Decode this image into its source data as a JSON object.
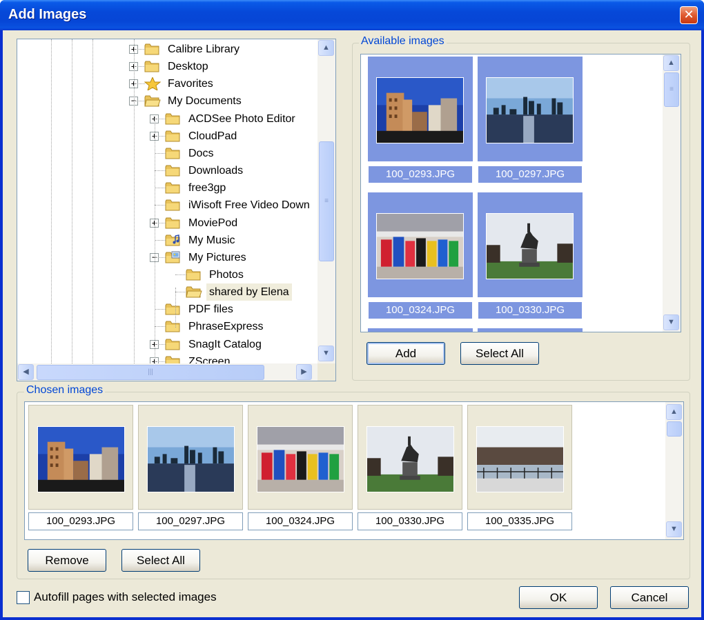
{
  "window": {
    "title": "Add Images"
  },
  "tree": {
    "items": [
      {
        "label": "Calibre Library",
        "level": 0,
        "expander": "+",
        "icon": "folder-icon"
      },
      {
        "label": "Desktop",
        "level": 0,
        "expander": "+",
        "icon": "folder-icon"
      },
      {
        "label": "Favorites",
        "level": 0,
        "expander": "+",
        "icon": "star-icon"
      },
      {
        "label": "My Documents",
        "level": 0,
        "expander": "−",
        "icon": "folder-open-icon"
      },
      {
        "label": "ACDSee Photo Editor",
        "level": 1,
        "expander": "+",
        "icon": "folder-icon"
      },
      {
        "label": "CloudPad",
        "level": 1,
        "expander": "+",
        "icon": "folder-icon"
      },
      {
        "label": "Docs",
        "level": 1,
        "expander": "",
        "icon": "folder-icon"
      },
      {
        "label": "Downloads",
        "level": 1,
        "expander": "",
        "icon": "folder-icon"
      },
      {
        "label": "free3gp",
        "level": 1,
        "expander": "",
        "icon": "folder-icon"
      },
      {
        "label": "iWisoft Free Video Down",
        "level": 1,
        "expander": "",
        "icon": "folder-icon"
      },
      {
        "label": "MoviePod",
        "level": 1,
        "expander": "+",
        "icon": "folder-icon"
      },
      {
        "label": "My Music",
        "level": 1,
        "expander": "",
        "icon": "music-folder-icon"
      },
      {
        "label": "My Pictures",
        "level": 1,
        "expander": "−",
        "icon": "pictures-folder-icon"
      },
      {
        "label": "Photos",
        "level": 2,
        "expander": "",
        "icon": "folder-icon"
      },
      {
        "label": "shared by Elena",
        "level": 2,
        "expander": "",
        "icon": "folder-open-icon",
        "selected": true
      },
      {
        "label": "PDF files",
        "level": 1,
        "expander": "",
        "icon": "folder-icon"
      },
      {
        "label": "PhraseExpress",
        "level": 1,
        "expander": "",
        "icon": "folder-icon"
      },
      {
        "label": "SnagIt Catalog",
        "level": 1,
        "expander": "+",
        "icon": "folder-icon"
      },
      {
        "label": "ZScreen",
        "level": 1,
        "expander": "+",
        "icon": "folder-icon"
      }
    ]
  },
  "available": {
    "label": "Available images",
    "images": [
      {
        "name": "100_0293.JPG",
        "scene": "building"
      },
      {
        "name": "100_0297.JPG",
        "scene": "skyline"
      },
      {
        "name": "100_0324.JPG",
        "scene": "newsboxes"
      },
      {
        "name": "100_0330.JPG",
        "scene": "statue"
      }
    ],
    "add_label": "Add",
    "select_all_label": "Select All"
  },
  "chosen": {
    "label": "Chosen images",
    "images": [
      {
        "name": "100_0293.JPG",
        "scene": "building"
      },
      {
        "name": "100_0297.JPG",
        "scene": "skyline"
      },
      {
        "name": "100_0324.JPG",
        "scene": "newsboxes"
      },
      {
        "name": "100_0330.JPG",
        "scene": "statue"
      },
      {
        "name": "100_0335.JPG",
        "scene": "park"
      }
    ],
    "remove_label": "Remove",
    "select_all_label": "Select All"
  },
  "autofill": {
    "label": "Autofill pages with selected images",
    "checked": false
  },
  "buttons": {
    "ok": "OK",
    "cancel": "Cancel"
  },
  "colors": {
    "selection": "#7d96e0",
    "group_label": "#0046d5",
    "face": "#ece9d8"
  }
}
